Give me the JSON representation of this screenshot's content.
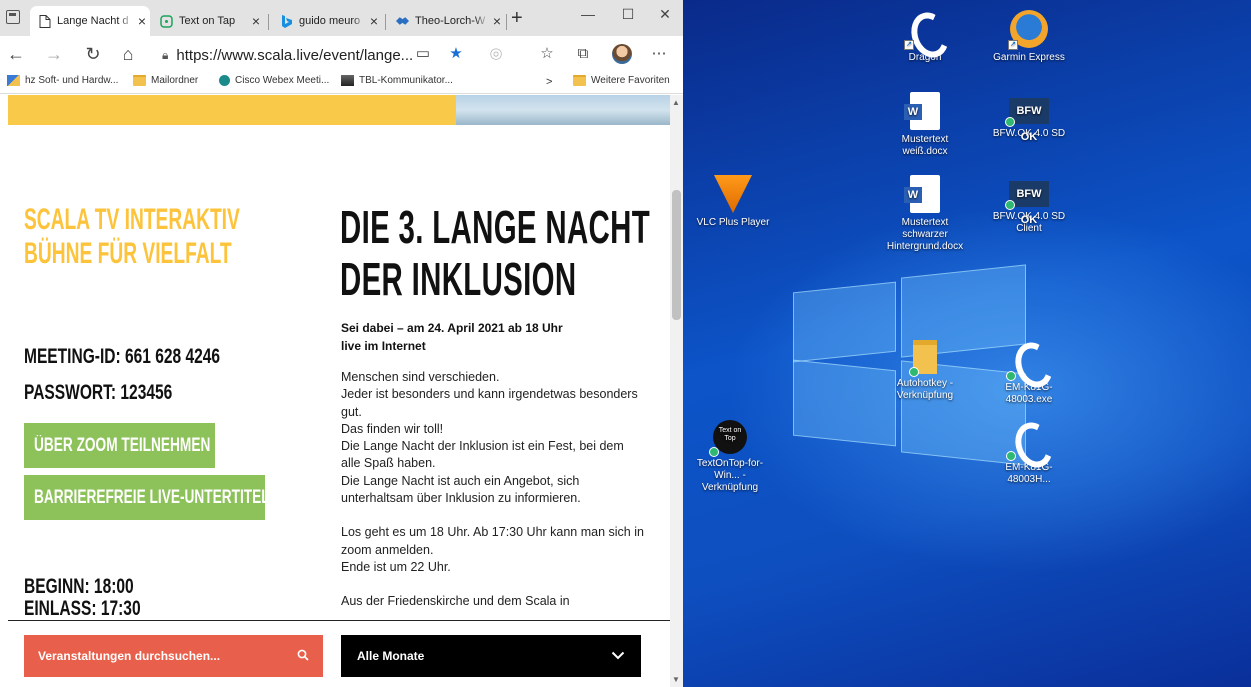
{
  "browser": {
    "tabs": [
      {
        "title": "Lange Nacht d",
        "icon": "document-icon",
        "active": true
      },
      {
        "title": "Text on Tap",
        "icon": "chat-icon",
        "active": false
      },
      {
        "title": "guido meuro",
        "icon": "bing-icon",
        "active": false
      },
      {
        "title": "Theo-Lorch-W",
        "icon": "handshake-icon",
        "active": false
      }
    ],
    "new_tab": "+",
    "window_controls": {
      "minimize": "—",
      "maximize": "☐",
      "close": "✕"
    },
    "url": "https://www.scala.live/event/lange...",
    "favorites": [
      {
        "label": "hz Soft- und Hardw...",
        "icon": "bookmark-icon"
      },
      {
        "label": "Mailordner",
        "icon": "folder-icon"
      },
      {
        "label": "Cisco Webex Meeti...",
        "icon": "webex-icon"
      },
      {
        "label": "TBL-Kommunikator...",
        "icon": "app-icon"
      }
    ],
    "favorites_more": ">",
    "favorites_folder": "Weitere Favoriten"
  },
  "page": {
    "left_title_1": "SCALA TV INTERAKTIV",
    "left_title_2": "BÜHNE FÜR VIELFALT",
    "meeting_id": "MEETING-ID: 661 628 4246",
    "password": "PASSWORT: 123456",
    "zoom_button": "ÜBER ZOOM TEILNEHMEN",
    "subtitle_button": "BARRIEREFREIE LIVE-UNTERTITEL",
    "begin": "BEGINN: 18:00",
    "entry": "EINLASS: 17:30",
    "main_title_1": "DIE 3. LANGE NACHT",
    "main_title_2": "DER INKLUSION",
    "lead_1": "Sei dabei – am 24. April 2021 ab 18 Uhr",
    "lead_2": "live im Internet",
    "paragraph_1": "Menschen sind verschieden.\nJeder ist besonders und kann irgendetwas besonders gut.\nDas finden wir toll!\nDie Lange Nacht der Inklusion ist ein Fest, bei dem alle Spaß haben.\nDie Lange Nacht ist auch ein Angebot, sich unterhaltsam über Inklusion zu informieren.",
    "paragraph_2": "Los geht es um 18 Uhr. Ab 17:30 Uhr kann man sich in zoom anmelden.\nEnde ist um 22 Uhr.",
    "paragraph_3": "Aus der Friedenskirche und dem Scala in",
    "search_label": "Veranstaltungen durchsuchen...",
    "month_label": "Alle Monate",
    "accent_yellow": "#fcc33b",
    "accent_green": "#8dc15a",
    "accent_red": "#e8604c"
  },
  "desktop": {
    "icons": [
      {
        "label": "Dragon",
        "icon": "dragon-icon"
      },
      {
        "label": "Garmin Express",
        "icon": "garmin-icon"
      },
      {
        "label": "Mustertext weiß.docx",
        "icon": "word-doc-icon"
      },
      {
        "label": "BFW.OK 4.0 SD",
        "icon": "bfw-ok-icon"
      },
      {
        "label": "VLC Plus Player",
        "icon": "vlc-icon"
      },
      {
        "label": "Mustertext schwarzer Hintergrund.docx",
        "icon": "word-doc-icon"
      },
      {
        "label": "BFW.OK 4.0 SD Client",
        "icon": "bfw-ok-icon"
      },
      {
        "label": "Autohotkey - Verknüpfung",
        "icon": "folder-icon"
      },
      {
        "label": "EM-K81G-48003.exe",
        "icon": "dragon-icon"
      },
      {
        "label": "TextOnTop-for-Win... - Verknüpfung",
        "icon": "textontop-icon"
      },
      {
        "label": "EM-K81G-48003H...",
        "icon": "dragon-icon"
      }
    ],
    "bfw_logo_text": "BFW OK",
    "textontop_logo_text": "Text on Top"
  }
}
